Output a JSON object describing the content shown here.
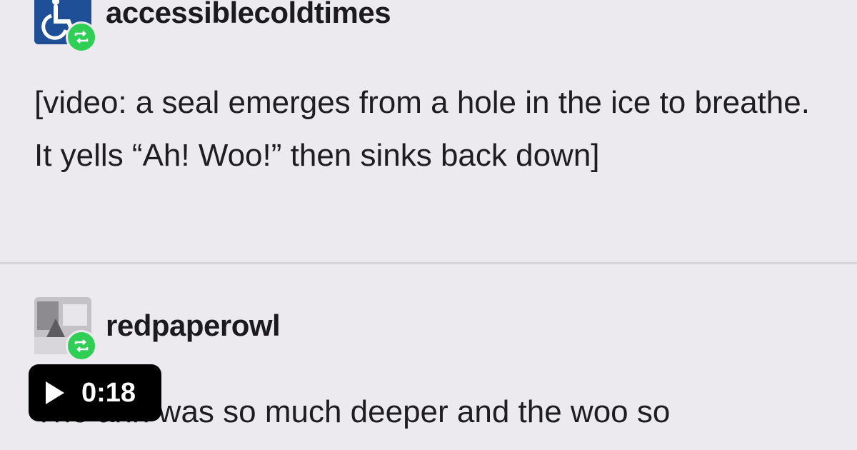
{
  "posts": [
    {
      "username": "accessiblecoldtimes",
      "avatar_icon": "wheelchair-icon",
      "badge_icon": "reblog-icon",
      "text": "[video: a seal emerges from a hole in the ice to breathe. It yells “Ah! Woo!” then sinks back down]"
    },
    {
      "username": "redpaperowl",
      "avatar_icon": "photo-avatar",
      "badge_icon": "reblog-icon",
      "text": "The ahh was so much deeper and the woo so"
    }
  ],
  "video": {
    "play_icon": "play-icon",
    "duration": "0:18"
  },
  "colors": {
    "background": "#eceaee",
    "reblog_badge": "#2fcf55",
    "avatar_primary": "#1f4f96"
  }
}
